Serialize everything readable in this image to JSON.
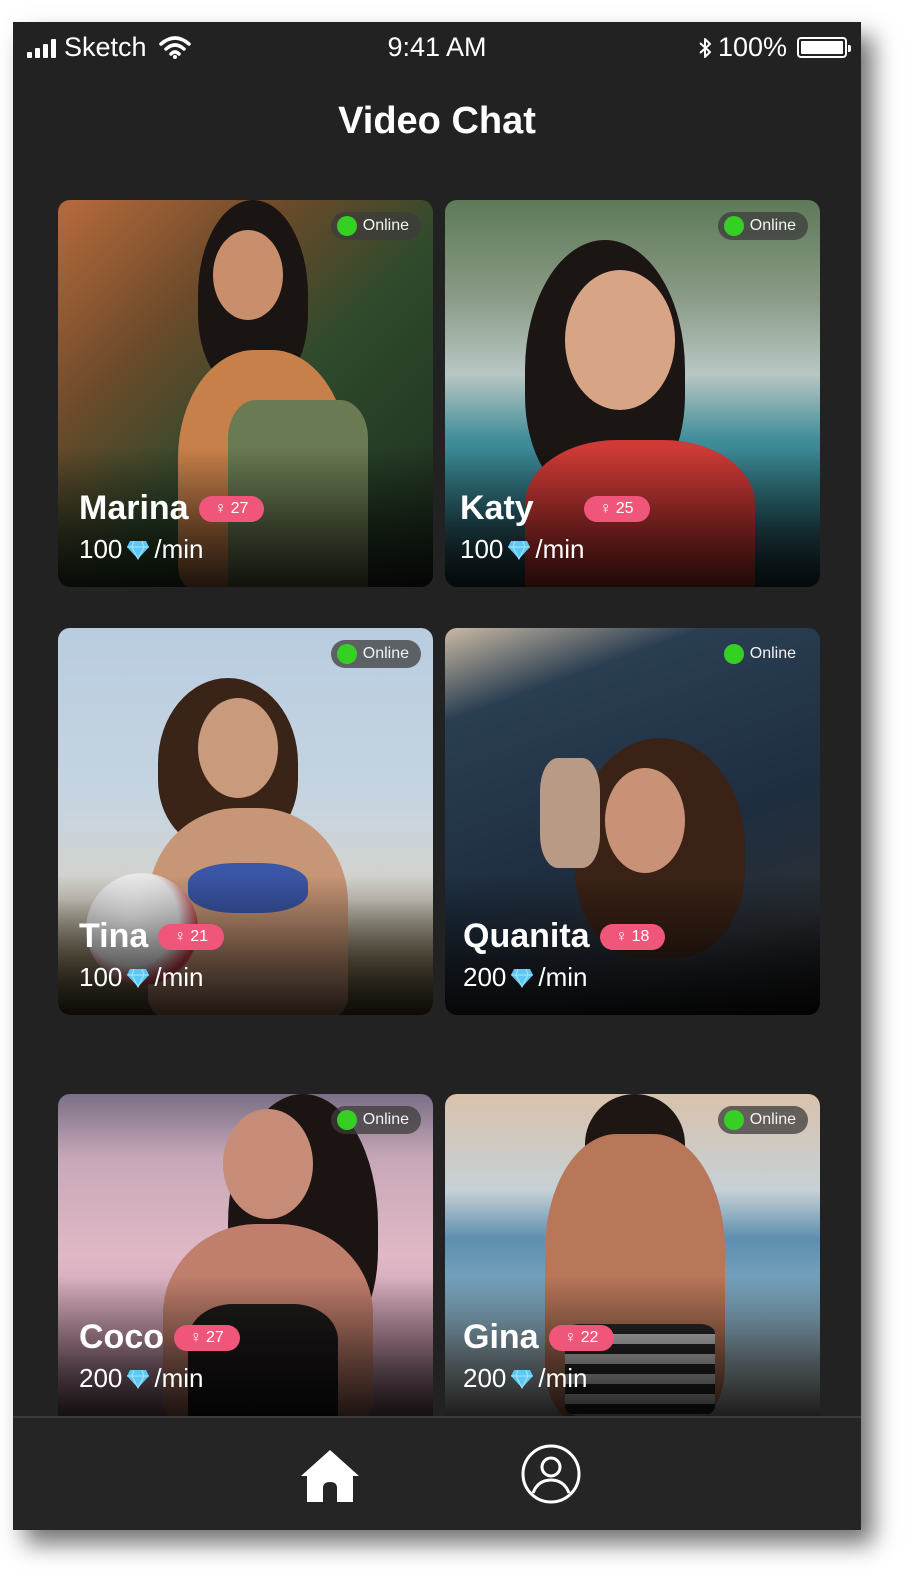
{
  "status_bar": {
    "carrier": "Sketch",
    "time": "9:41 AM",
    "battery": "100%"
  },
  "header": {
    "title": "Video Chat"
  },
  "cards": [
    {
      "name": "Marina",
      "age": "27",
      "price": "100",
      "unit": "/min",
      "status": "Online"
    },
    {
      "name": "Katy",
      "age": "25",
      "price": "100",
      "unit": "/min",
      "status": "Online"
    },
    {
      "name": "Tina",
      "age": "21",
      "price": "100",
      "unit": "/min",
      "status": "Online"
    },
    {
      "name": "Quanita",
      "age": "18",
      "price": "200",
      "unit": "/min",
      "status": "Online"
    },
    {
      "name": "Coco",
      "age": "27",
      "price": "200",
      "unit": "/min",
      "status": "Online"
    },
    {
      "name": "Gina",
      "age": "22",
      "price": "200",
      "unit": "/min",
      "status": "Online"
    }
  ],
  "tabbar": {
    "items": [
      {
        "icon": "home-icon",
        "active": true
      },
      {
        "icon": "profile-icon",
        "active": false
      }
    ]
  },
  "colors": {
    "background": "#222222",
    "age_badge": "#f0557a",
    "online_dot": "#35d023",
    "gem": "#5ec8f2"
  }
}
